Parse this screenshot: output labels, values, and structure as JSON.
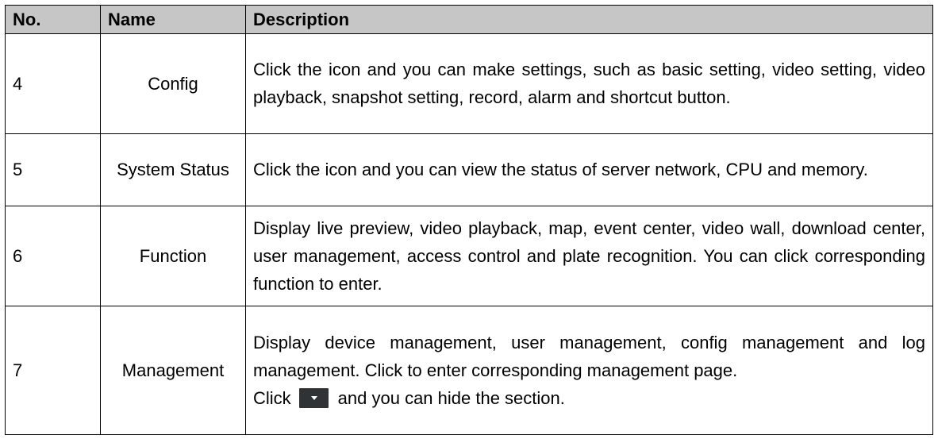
{
  "table": {
    "headers": [
      "No.",
      "Name",
      "Description"
    ],
    "rows": [
      {
        "no": "4",
        "name": "Config",
        "description": "Click the icon and you can make settings, such as basic setting, video setting, video playback, snapshot setting, record, alarm and shortcut button."
      },
      {
        "no": "5",
        "name": "System Status",
        "description": "Click the icon and you can view the status of server network, CPU and memory."
      },
      {
        "no": "6",
        "name": "Function",
        "description": "Display live preview, video playback, map, event center, video wall, download center, user management, access control and plate recognition. You can click corresponding function to enter."
      },
      {
        "no": "7",
        "name": "Management",
        "description": "Display device management, user management, config management and log management. Click to enter corresponding management page.",
        "extra_before_icon": "Click",
        "extra_icon": "dropdown-arrow-icon",
        "extra_after_icon": "and you can hide the section."
      }
    ]
  }
}
